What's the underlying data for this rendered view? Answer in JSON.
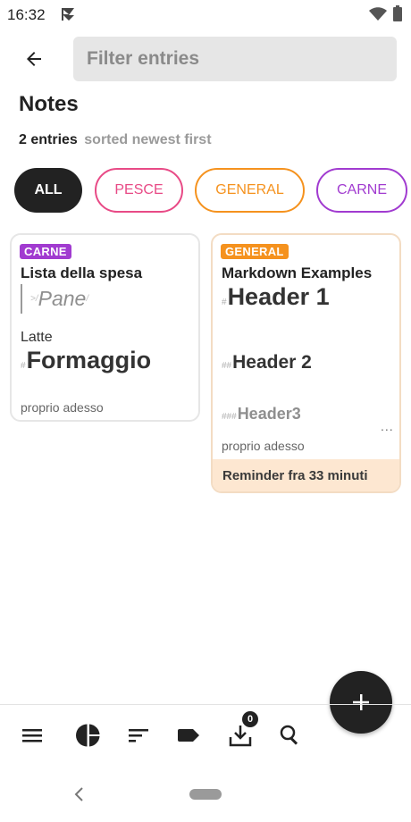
{
  "status_bar": {
    "time": "16:32"
  },
  "search": {
    "placeholder": "Filter entries",
    "value": ""
  },
  "page": {
    "title": "Notes",
    "entries_count": "2 entries",
    "sort_text": "sorted newest first"
  },
  "filters": [
    {
      "label": "ALL",
      "selected": true,
      "color": "#222222"
    },
    {
      "label": "PESCE",
      "selected": false,
      "color": "#e84a86"
    },
    {
      "label": "GENERAL",
      "selected": false,
      "color": "#f5921e"
    },
    {
      "label": "CARNE",
      "selected": false,
      "color": "#a13bd0"
    }
  ],
  "cards": [
    {
      "tag": "CARNE",
      "tag_color": "#a13bd0",
      "title": "Lista della spesa",
      "quote_mark_open": ">/",
      "quote_text": "Pane",
      "quote_mark_close": "/",
      "line": "Latte",
      "heading_hash": "#",
      "heading": "Formaggio",
      "time": "proprio adesso"
    },
    {
      "tag": "GENERAL",
      "tag_color": "#f5921e",
      "title": "Markdown Examples",
      "h1_hash": "#",
      "h1": "Header 1",
      "h2_hash": "##",
      "h2": "Header 2",
      "h3_hash": "###",
      "h3": "Header3",
      "more": "...",
      "time": "proprio adesso",
      "reminder": "Reminder fra 33 minuti"
    }
  ],
  "bottom_bar": {
    "icons": [
      "menu-icon",
      "pie-chart-icon",
      "sort-icon",
      "label-icon",
      "download-icon",
      "search-icon"
    ],
    "download_badge": "0"
  },
  "fab": {
    "icon": "plus-icon"
  },
  "colors": {
    "accent_dark": "#222222",
    "reminder_bg": "#fde7d1"
  }
}
